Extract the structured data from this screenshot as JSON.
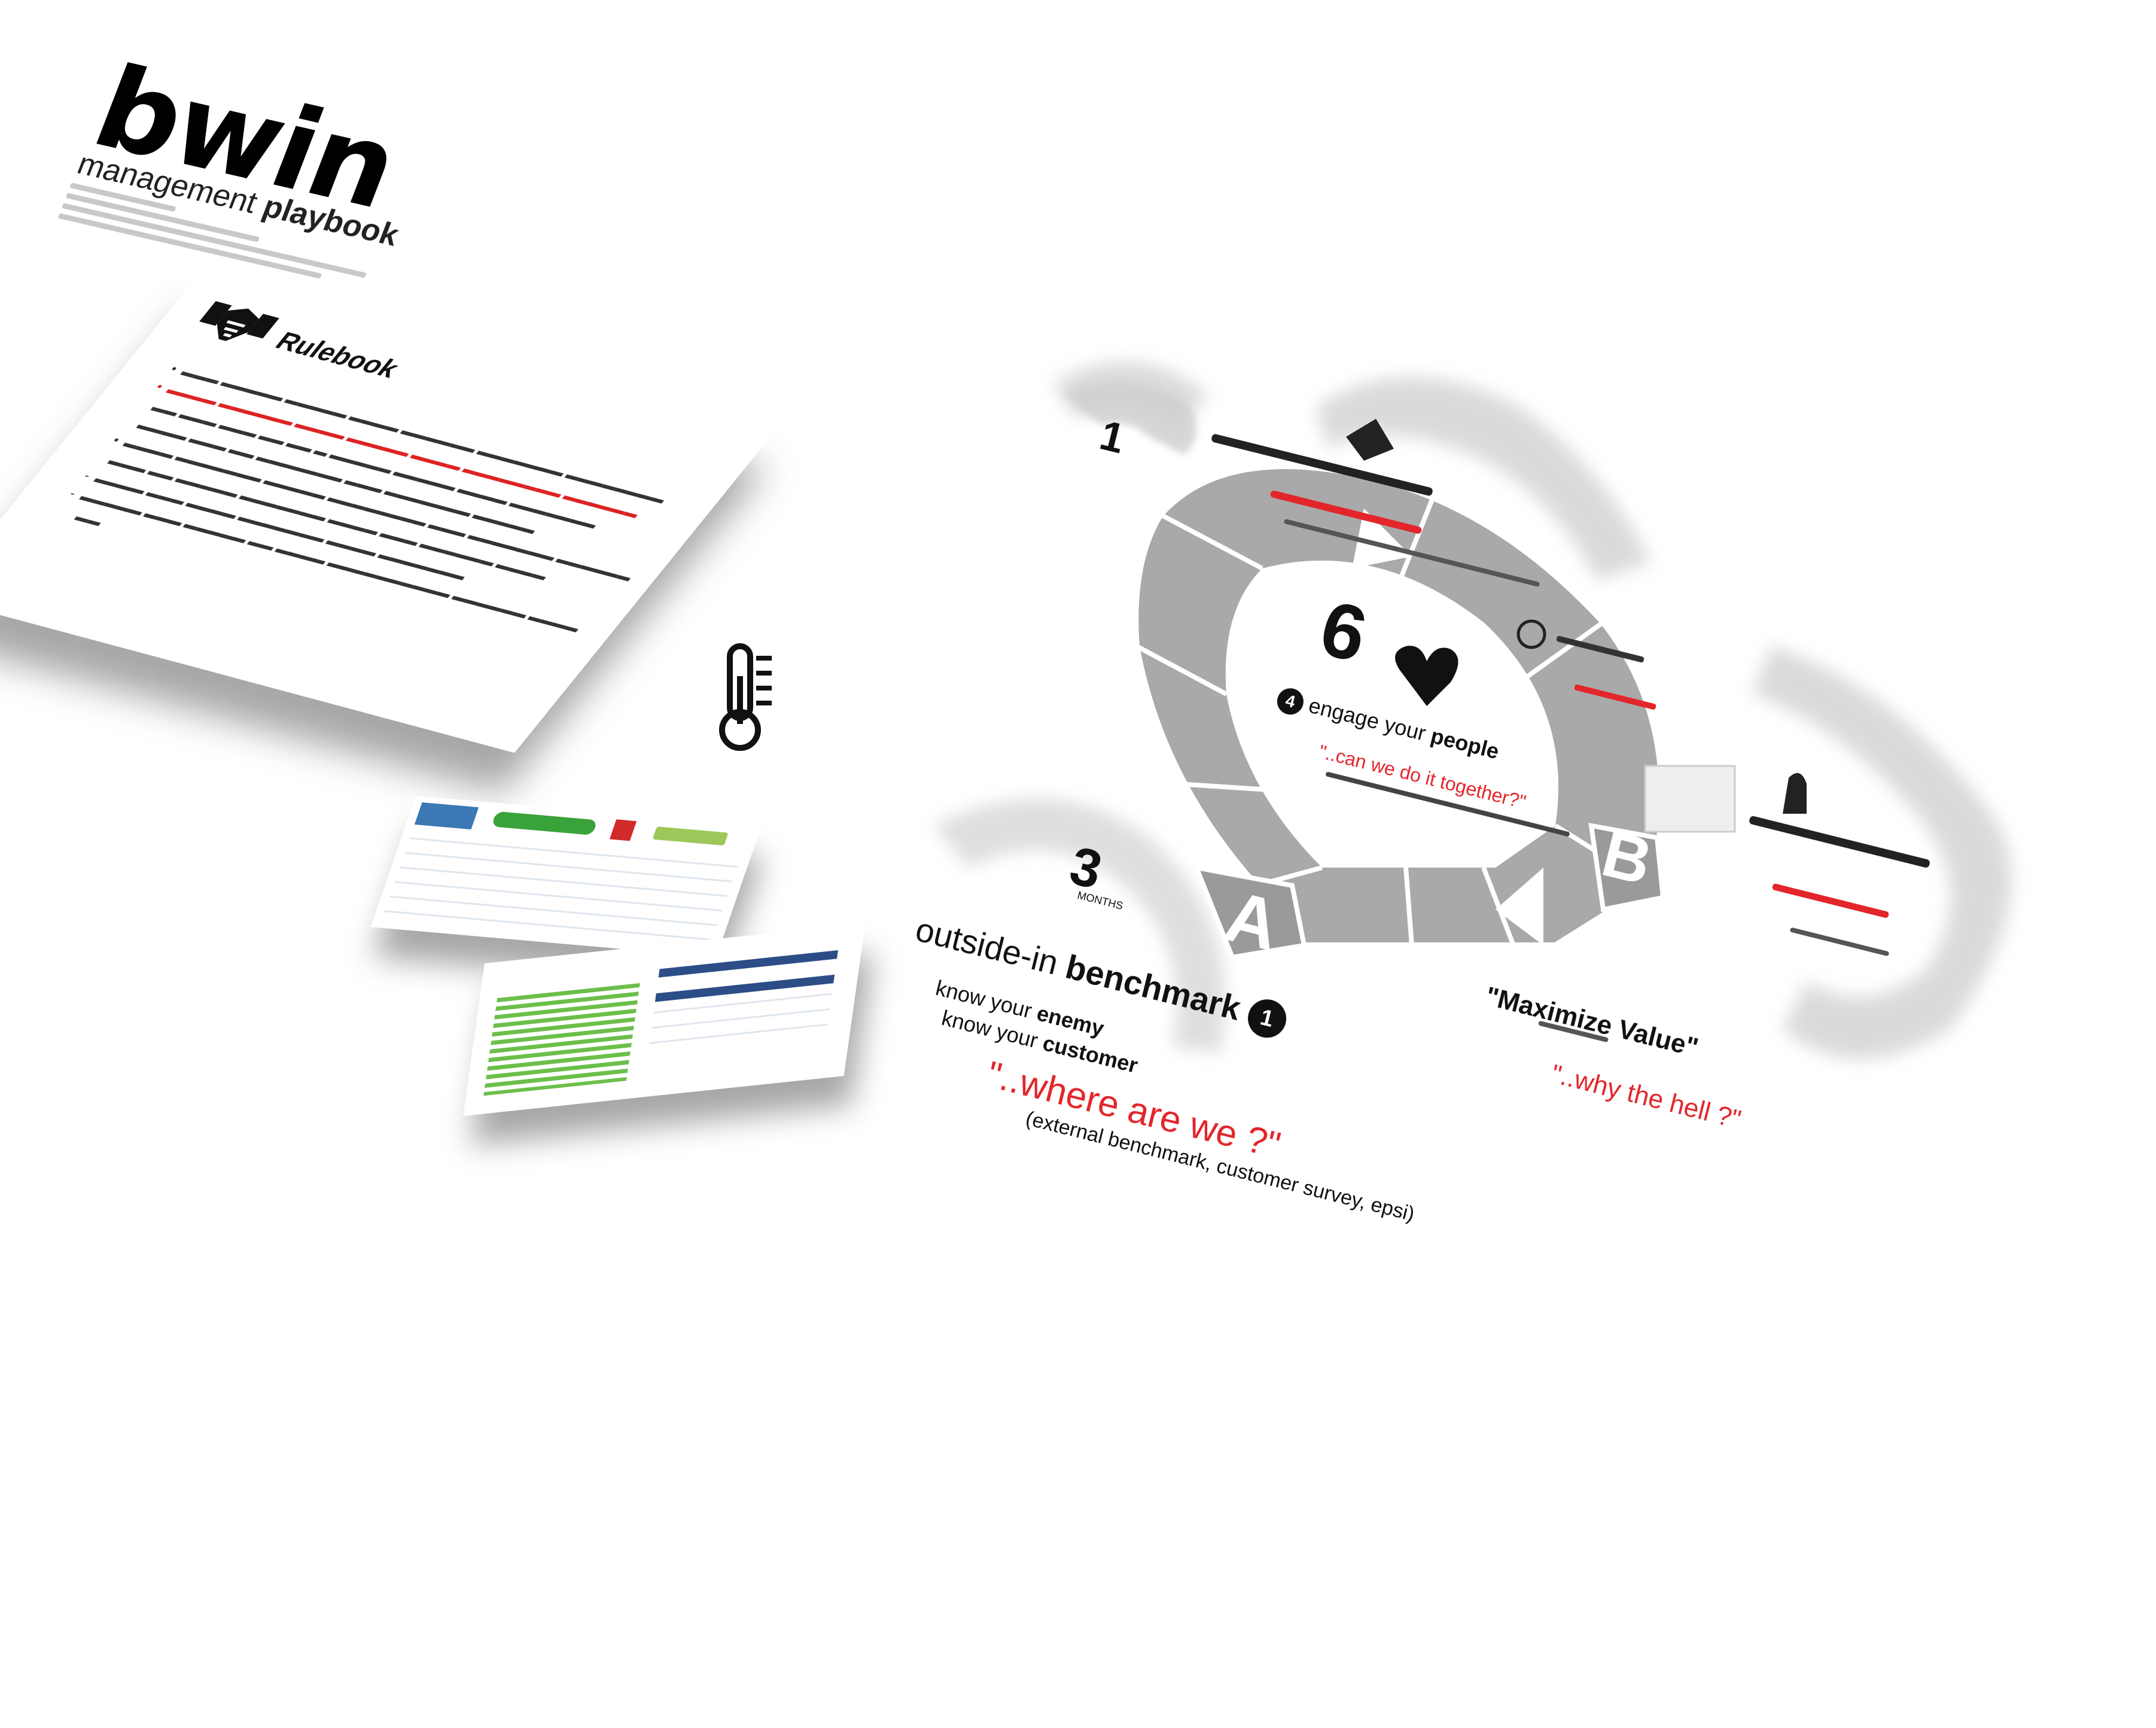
{
  "title_block": {
    "logo": "bwin",
    "subtitle_prefix": "management",
    "subtitle_bold": "playbook"
  },
  "rulebook": {
    "title": "Rulebook",
    "icon": "handshake-icon"
  },
  "diagram": {
    "center_number": "6",
    "heart_icon": "heart-icon",
    "top_number": "1",
    "left_number": "3",
    "left_sub": "MONTHS",
    "label_A": "A",
    "label_B": "B",
    "step1": {
      "num": "1",
      "title_plain": "outside-in",
      "title_bold": "benchmark",
      "line1_plain": "know your",
      "line1_bold": "enemy",
      "line2_plain": "know your",
      "line2_bold": "customer",
      "question": "\"..where are we ?\"",
      "note": "(external benchmark, customer survey, epsi)",
      "icon": "thermometer-icon"
    },
    "step4": {
      "num": "4",
      "title_plain": "engage your",
      "title_bold": "people",
      "question": "\"..can we do it together?\""
    },
    "maximize": {
      "title": "\"Maximize Value\"",
      "question": "\"..why the hell ?\""
    }
  }
}
